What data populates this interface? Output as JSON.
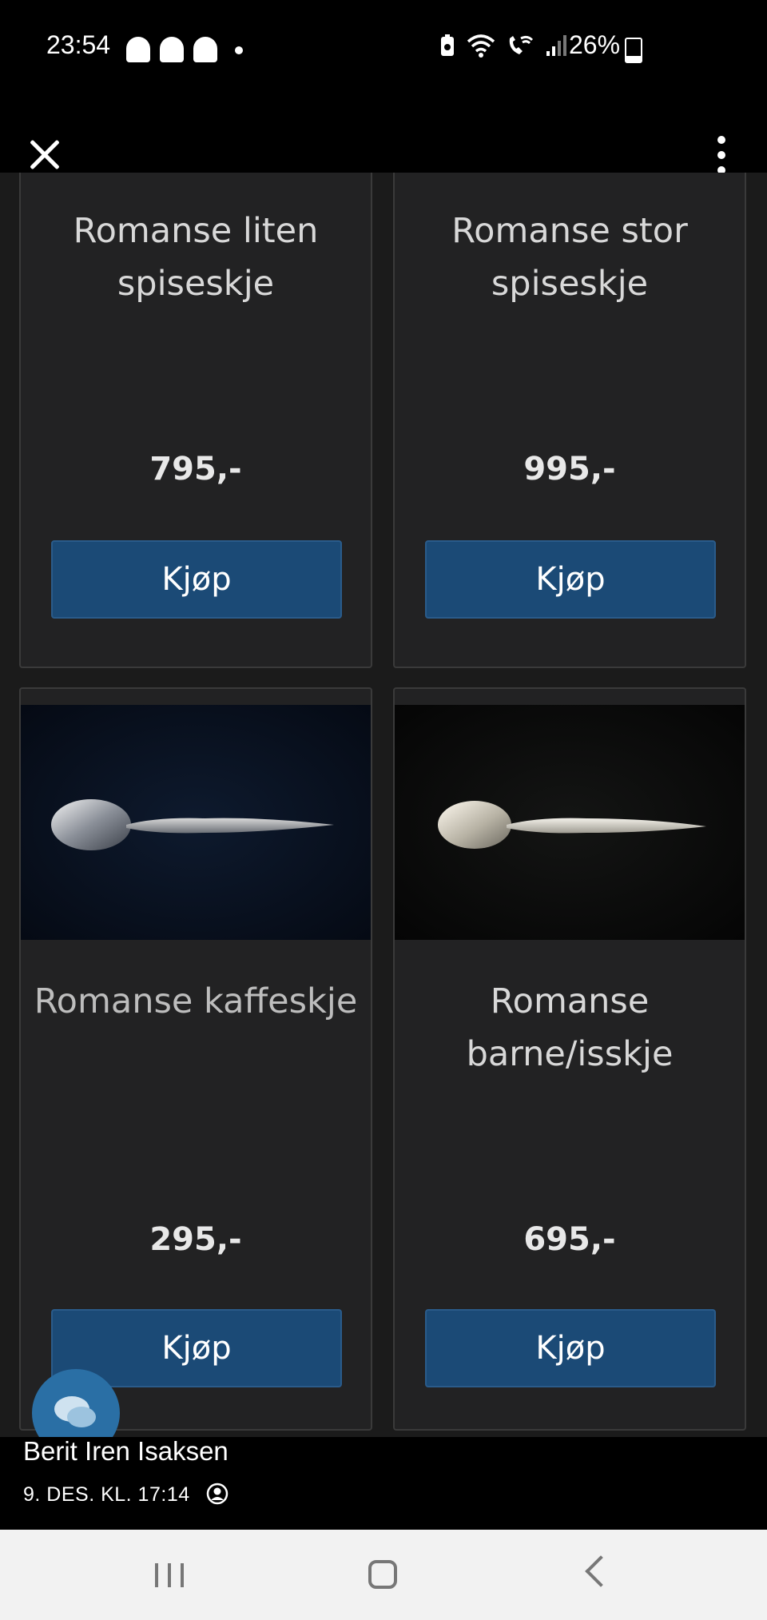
{
  "status_bar": {
    "time": "23:54",
    "battery_pct": "26%",
    "battery_level": 0.26,
    "notification_icons": [
      "snapchat-icon",
      "snapchat-icon",
      "snapchat-icon",
      "dot-icon"
    ],
    "system_icons": [
      "battery-saver-icon",
      "wifi-icon",
      "wifi-calling-icon",
      "signal-icon"
    ]
  },
  "top_bar": {
    "close_icon": "close-icon",
    "menu_icon": "more-vert-icon"
  },
  "products": [
    {
      "title": "Romanse liten spiseskje",
      "price": "795,-",
      "buy_label": "Kjøp"
    },
    {
      "title": "Romanse stor spiseskje",
      "price": "995,-",
      "buy_label": "Kjøp"
    },
    {
      "title": "Romanse kaffeskje",
      "price": "295,-",
      "buy_label": "Kjøp",
      "image": "spoon-photo"
    },
    {
      "title": "Romanse barne/isskje",
      "price": "695,-",
      "buy_label": "Kjøp",
      "image": "spoon-photo"
    }
  ],
  "chat_fab": {
    "icon": "chat-bubbles-icon"
  },
  "caption": {
    "author": "Berit Iren Isaksen",
    "date": "9. DES. KL. 17:14",
    "audience_icon": "friends-icon"
  },
  "nav_bar": {
    "recent_icon": "recent-apps-icon",
    "home_icon": "home-icon",
    "back_icon": "back-icon"
  },
  "colors": {
    "button_bg": "#1b4a76",
    "card_bg": "#222223",
    "page_bg": "#1b1b1b",
    "chat_fab_bg": "#2a6fa5"
  }
}
